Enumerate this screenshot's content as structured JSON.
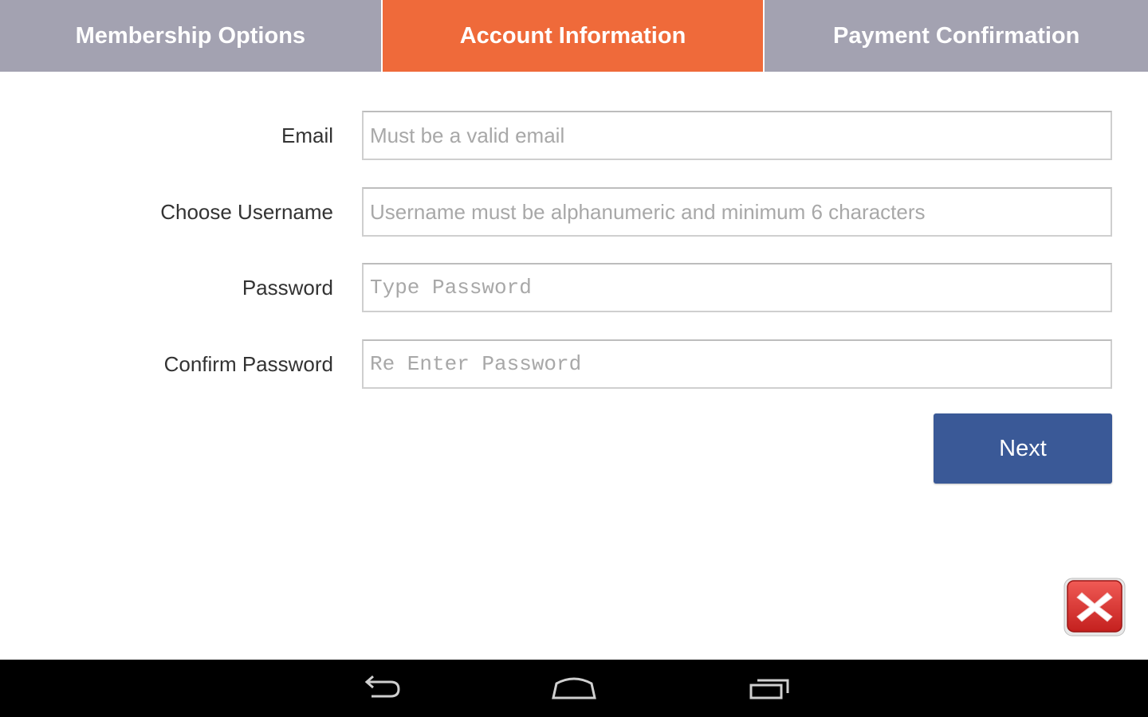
{
  "tabs": [
    {
      "label": "Membership Options",
      "active": false
    },
    {
      "label": "Account Information",
      "active": true
    },
    {
      "label": "Payment Confirmation",
      "active": false
    }
  ],
  "form": {
    "email": {
      "label": "Email",
      "placeholder": "Must be a valid email",
      "value": ""
    },
    "username": {
      "label": "Choose Username",
      "placeholder": "Username must be alphanumeric and minimum 6 characters",
      "value": ""
    },
    "password": {
      "label": "Password",
      "placeholder": "Type Password",
      "value": ""
    },
    "confirm_password": {
      "label": "Confirm Password",
      "placeholder": "Re Enter Password",
      "value": ""
    }
  },
  "next_button": {
    "label": "Next"
  },
  "close_button": {
    "icon": "close-icon"
  },
  "navbar": {
    "back_icon": "back-icon",
    "home_icon": "home-icon",
    "recents_icon": "recent-apps-icon"
  },
  "colors": {
    "tab_inactive": "#a3a2b1",
    "tab_active": "#ef6a3a",
    "next_button": "#3a5997",
    "close_button": "#d9302f"
  }
}
